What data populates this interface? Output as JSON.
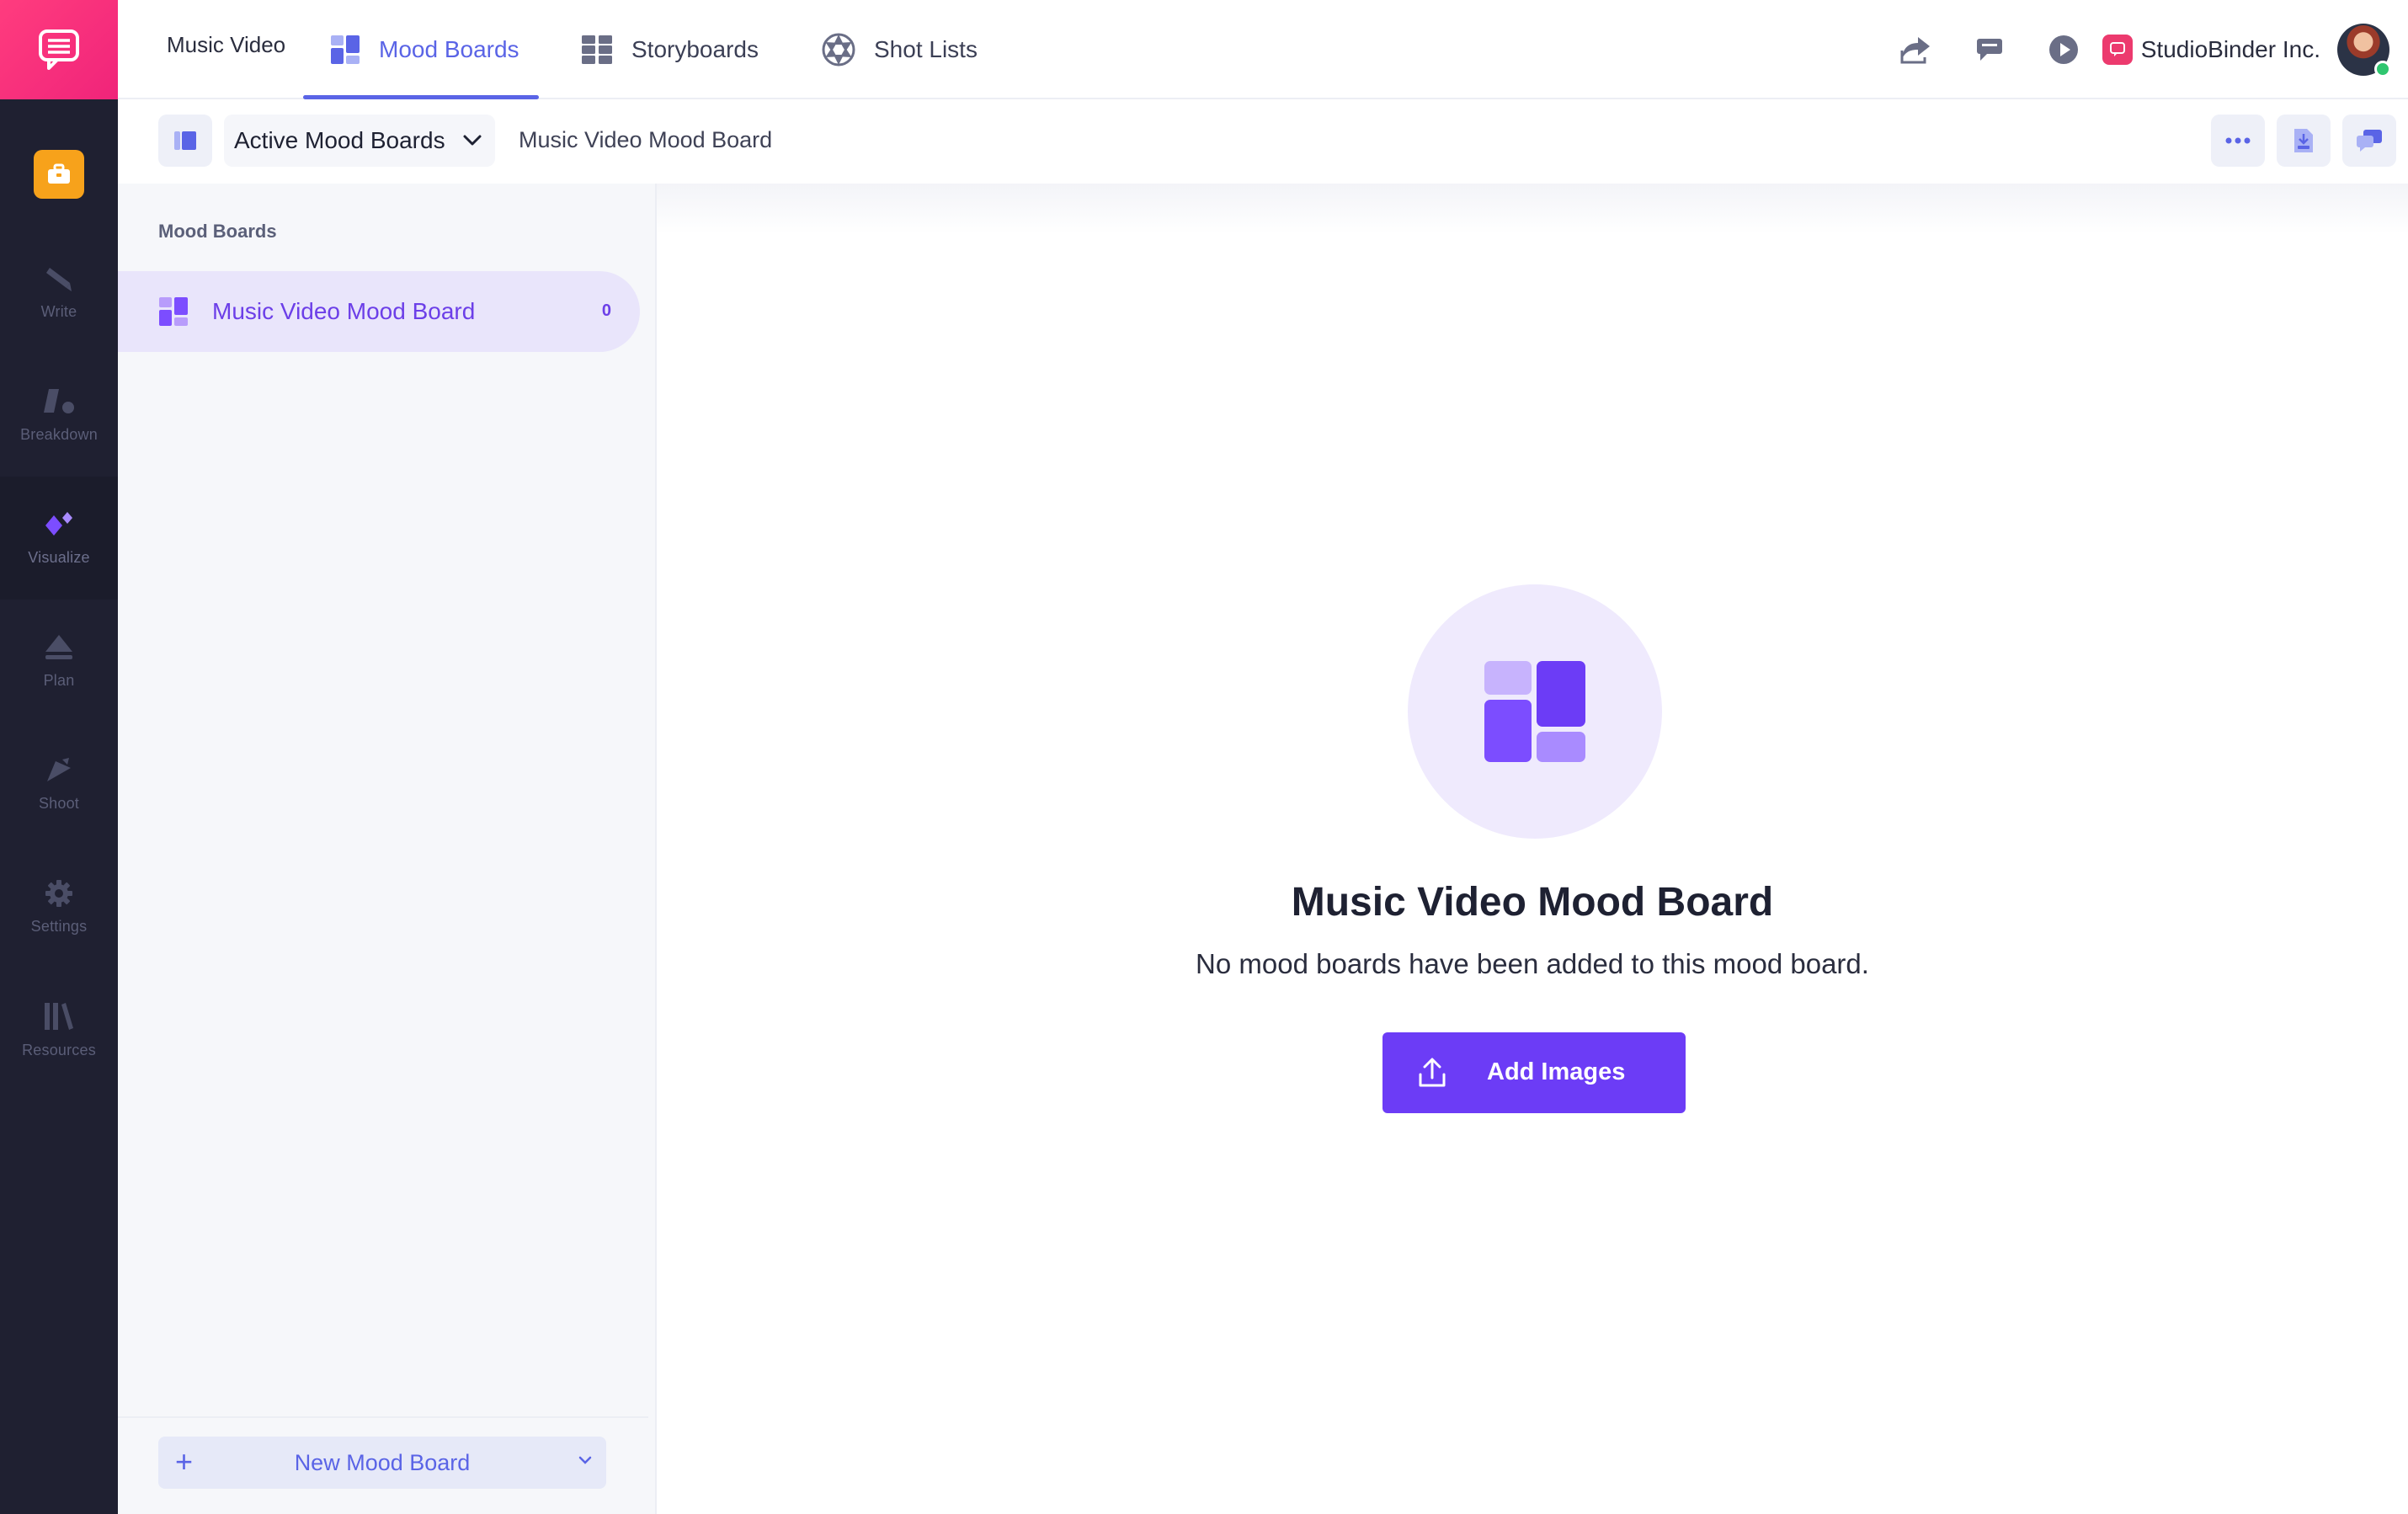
{
  "rail": {
    "items": [
      {
        "label": "Write",
        "icon": "pencil-icon"
      },
      {
        "label": "Breakdown",
        "icon": "breakdown-icon"
      },
      {
        "label": "Visualize",
        "icon": "visualize-icon"
      },
      {
        "label": "Plan",
        "icon": "plan-icon"
      },
      {
        "label": "Shoot",
        "icon": "shoot-icon"
      },
      {
        "label": "Settings",
        "icon": "gear-icon"
      },
      {
        "label": "Resources",
        "icon": "books-icon"
      }
    ],
    "active_item": "Visualize"
  },
  "topbar": {
    "project": "Music Video",
    "tabs": [
      {
        "label": "Mood Boards",
        "icon": "moodboard-icon",
        "active": true
      },
      {
        "label": "Storyboards",
        "icon": "storyboard-icon",
        "active": false
      },
      {
        "label": "Shot Lists",
        "icon": "aperture-icon",
        "active": false
      }
    ],
    "company": "StudioBinder Inc."
  },
  "subbar": {
    "dropdown_label": "Active Mood Boards",
    "current": "Music Video Mood Board"
  },
  "panel": {
    "heading": "Mood Boards",
    "boards": [
      {
        "label": "Music Video Mood Board",
        "count": "0"
      }
    ],
    "new_button": "New Mood Board"
  },
  "main": {
    "title": "Music Video Mood Board",
    "subtitle": "No mood boards have been added to this mood board.",
    "add_button": "Add Images"
  },
  "colors": {
    "brand": "#f0247a",
    "accent": "#5a64e6",
    "primary_button": "#6c3cf6",
    "rail_bg": "#1f2031"
  }
}
